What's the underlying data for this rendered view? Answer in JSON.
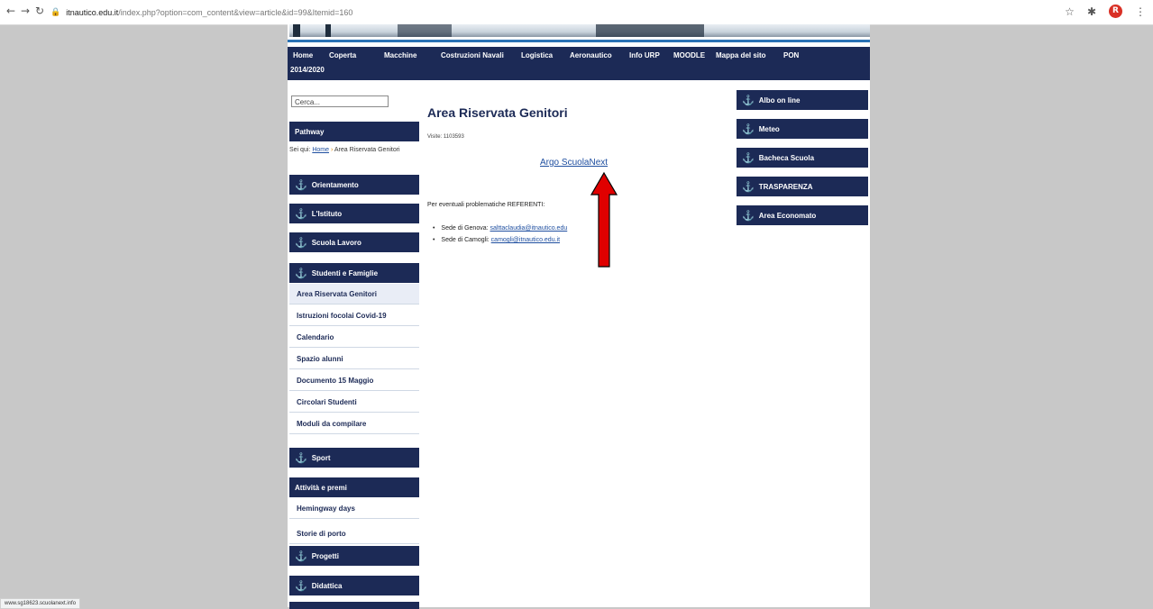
{
  "browser": {
    "url_host": "itnautico.edu.it",
    "url_path": "/index.php?option=com_content&view=article&id=99&Itemid=160",
    "profile_initial": "R",
    "status_url": "www.sg18623.scuolanext.info"
  },
  "topnav": {
    "items": [
      "Home",
      "Coperta",
      "Macchine",
      "Costruzioni Navali",
      "Logistica",
      "Aeronautico",
      "Info URP",
      "MOODLE",
      "Mappa del sito",
      "PON"
    ],
    "second_line": "2014/2020"
  },
  "search": {
    "placeholder": "Cerca..."
  },
  "pathway": {
    "title": "Pathway",
    "prefix": "Sei qui:",
    "home": "Home",
    "separator": "›",
    "current": "Area Riservata Genitori"
  },
  "left_menu": {
    "orientamento": "Orientamento",
    "istituto": "L'Istituto",
    "scuola_lavoro": "Scuola Lavoro",
    "studenti_famiglie": "Studenti e Famiglie",
    "sub": [
      "Area Riservata Genitori",
      "Istruzioni focolai Covid-19",
      "Calendario",
      "Spazio alunni",
      "Documento 15 Maggio",
      "Circolari Studenti",
      "Moduli da compilare"
    ],
    "sport": "Sport",
    "attivita": "Attività e premi",
    "sub2": [
      "Hemingway days",
      "Storie di porto"
    ],
    "progetti": "Progetti",
    "didattica": "Didattica"
  },
  "content": {
    "title": "Area Riservata Genitori",
    "visits": "Visite: 1103593",
    "argo_link": "Argo ScuolaNext",
    "referenti_intro": "Per eventuali problematiche REFERENTI:",
    "referenti": [
      {
        "label": "Sede di Genova:",
        "email": "salttaclaudia@itnautico.edu"
      },
      {
        "label": "Sede di Camogli:",
        "email": "camogli@itnautico.edu.it"
      }
    ]
  },
  "right_menu": [
    "Albo on line",
    "Meteo",
    "Bacheca Scuola",
    "TRASPARENZA",
    "Area Economato"
  ],
  "colors": {
    "nav_bg": "#1c2a56",
    "link": "#1f4fa0",
    "arrow": "#e00000",
    "page_bg": "#c8c8c8"
  },
  "icons": [
    "back-icon",
    "forward-icon",
    "reload-icon",
    "lock-icon",
    "star-icon",
    "extensions-icon",
    "menu-icon",
    "anchor-icon",
    "arrow-annotation"
  ]
}
